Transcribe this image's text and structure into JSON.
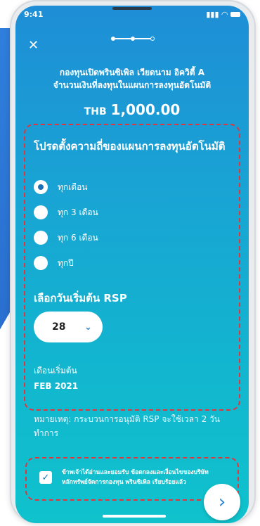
{
  "status": {
    "time": "9:41"
  },
  "header": {
    "close_icon": "close-icon",
    "fund_line1": "กองทุนเปิดพรินซิเพิล เวียดนาม อิควิตี้ A",
    "fund_line2": "จำนวนเงินที่ลงทุนในแผนการลงทุนอัตโนมัติ",
    "currency": "THB",
    "amount": "1,000.00"
  },
  "frequency": {
    "heading": "โปรดตั้งความถี่ของแผนการลงทุนอัตโนมัติ",
    "options": [
      "ทุกเดือน",
      "ทุก 3 เดือน",
      "ทุก 6 เดือน",
      "ทุกปี"
    ],
    "selected": "ทุกเดือน"
  },
  "start": {
    "heading": "เลือกวันเริ่มต้น RSP",
    "day_value": "28",
    "month_label": "เดือนเริ่มต้น",
    "month_value": "FEB 2021"
  },
  "note": "หมายเหตุ: กระบวนการอนุมัติ RSP จะใช้เวลา 2 วันทำการ",
  "consent": {
    "line1": "ข้าพเจ้าได้อ่านและยอมรับ ข้อตกลงและเงื่อนไขของบริษัท",
    "line2": "หลักทรัพย์จัดการกองทุน พรินซิเพิล เรียบร้อยแล้ว",
    "checked": true
  },
  "colors": {
    "accent": "#2a86d2",
    "highlight": "#e4343c"
  }
}
